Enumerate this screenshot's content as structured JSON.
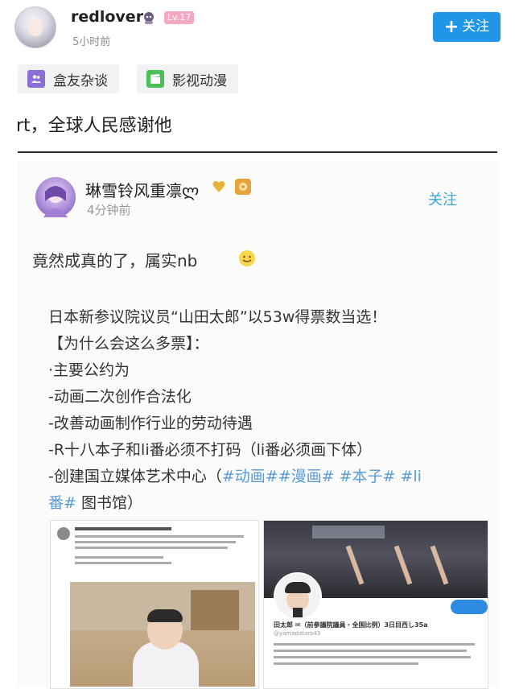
{
  "post": {
    "username": "redlover",
    "level": "Lv.17",
    "time": "5小时前",
    "follow_label": "关注",
    "tags": [
      {
        "label": "盒友杂谈",
        "icon": "people-icon",
        "color": "#8c6fd6"
      },
      {
        "label": "影视动漫",
        "icon": "clapperboard-icon",
        "color": "#4cbf5a"
      }
    ],
    "text": "rt，全球人民感谢他"
  },
  "embedded": {
    "username": "琳雪铃风重凛ლ",
    "time": "4分钟前",
    "follow_label": "关注",
    "text": "竟然成真的了，属实nb",
    "lines": [
      "日本新参议院议员“山田太郎”以53w得票数当选！",
      "【为什么会这么多票】：",
      "·主要公约为",
      "-动画二次创作合法化",
      "-改善动画制作行业的劳动待遇",
      "-R十八本子和li番必须不打码（li番必须画下体）",
      "-创建国立媒体艺术中心（",
      "#动画##漫画# #本子# #li",
      "番#",
      " 图书馆）"
    ],
    "screenshot_right": {
      "name": "田太郎 ✉（前参議院議員・全国比例）3日目西し35a",
      "handle": "@yamadataro43"
    }
  },
  "colors": {
    "accent": "#2196e8",
    "hashtag": "#5a9bd5",
    "inner_follow": "#3ba7d6",
    "level_badge": "#f3a8c3"
  }
}
